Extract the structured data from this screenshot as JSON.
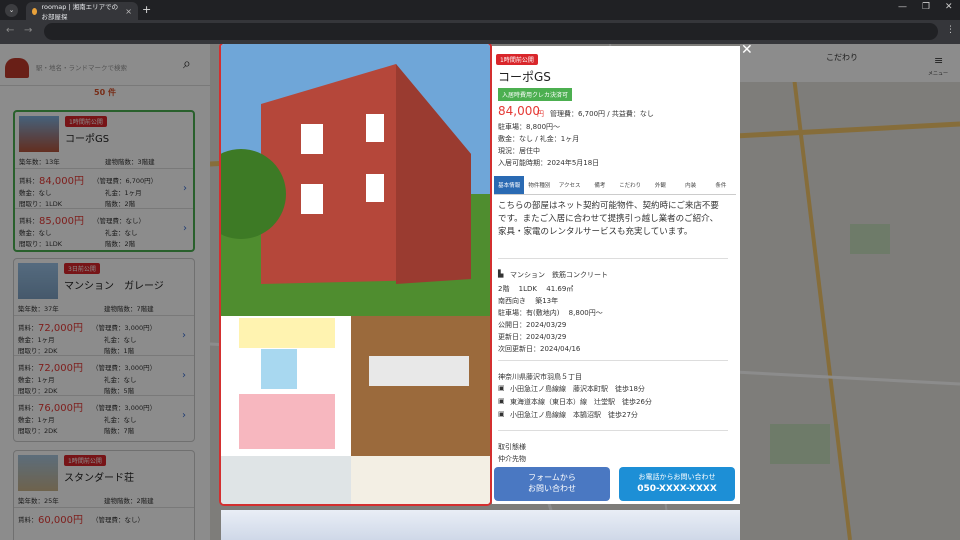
{
  "browser": {
    "tab_title": "roomap | 湘南エリアでのお部屋探",
    "tab_close": "×",
    "new_tab": "+",
    "tab_menu": "⌄",
    "back": "←",
    "forward": "→",
    "minimize": "—",
    "maximize": "❐",
    "close": "✕",
    "menu": "⋮"
  },
  "search": {
    "placeholder": "駅・地名・ランドマークで検索",
    "icon": "search-icon"
  },
  "result_count": "50 件",
  "listings": [
    {
      "badge": "1時間前公開",
      "name": "コーポGS",
      "age": "築年数：13年",
      "floors": "建物階数：3階建",
      "units": [
        {
          "rent": "84,000円",
          "fee": "（管理費：6,700円）",
          "deposit": "敷金：なし",
          "key": "礼金：1ヶ月",
          "layout": "間取り：1LDK",
          "floor": "階数：2階"
        },
        {
          "rent": "85,000円",
          "fee": "（管理費：なし）",
          "deposit": "敷金：なし",
          "key": "礼金：なし",
          "layout": "間取り：1LDK",
          "floor": "階数：2階"
        }
      ]
    },
    {
      "badge": "3日前公開",
      "name": "マンション　ガレージ",
      "age": "築年数：37年",
      "floors": "建物階数：7階建",
      "units": [
        {
          "rent": "72,000円",
          "fee": "（管理費：3,000円）",
          "deposit": "敷金：1ヶ月",
          "key": "礼金：なし",
          "layout": "間取り：2DK",
          "floor": "階数：1階"
        },
        {
          "rent": "72,000円",
          "fee": "（管理費：3,000円）",
          "deposit": "敷金：1ヶ月",
          "key": "礼金：なし",
          "layout": "間取り：2DK",
          "floor": "階数：5階"
        },
        {
          "rent": "76,000円",
          "fee": "（管理費：3,000円）",
          "deposit": "敷金：1ヶ月",
          "key": "礼金：なし",
          "layout": "間取り：2DK",
          "floor": "階数：7階"
        }
      ]
    },
    {
      "badge": "1時間前公開",
      "name": "スタンダード荘",
      "age": "築年数：25年",
      "floors": "建物階数：2階建",
      "units": [
        {
          "rent": "60,000円",
          "fee": "（管理費：なし）"
        }
      ]
    }
  ],
  "map_header": {
    "filter": "こだわり",
    "menu": "メニュー"
  },
  "detail": {
    "badge": "1時間前公開",
    "name": "コーポGS",
    "card_tag": "入居時費用クレカ決済可",
    "rent": "84,000",
    "rent_unit": "円",
    "fee": "管理費：6,700円 / 共益費：なし",
    "parking": "駐車場：8,800円～",
    "deposit": "敷金：なし / 礼金：1ヶ月",
    "status": "現況：居住中",
    "move_in": "入居可能時期：2024年5月18日",
    "tabs": [
      "基本情報",
      "物件種別",
      "アクセス",
      "備考",
      "こだわり",
      "外観",
      "内装",
      "条件"
    ],
    "description": "こちらの部屋はネット契約可能物件、契約時にご来店不要です。またご入居に合わせて提携引っ越し業者のご紹介、家具・家電のレンタルサービスも充実しています。",
    "structure": "マンション　鉄筋コンクリート",
    "spec": "2階　 1LDK　 41.69㎡",
    "direction": "南西向き　 築13年",
    "parking2": "駐車場：有(敷地内)　 8,800円～",
    "published": "公開日：2024/03/29",
    "updated": "更新日：2024/03/29",
    "next_update": "次回更新日：2024/04/16",
    "address": "神奈川県藤沢市羽鳥５丁目",
    "stations": [
      "小田急江ノ島線線　藤沢本町駅　徒歩18分",
      "東海道本線（東日本）線　辻堂駅　徒歩26分",
      "小田急江ノ島線線　本鵠沼駅　徒歩27分"
    ],
    "deal_type": "取引態様",
    "deal_value": "仲介先物",
    "cta_form": "フォームから\nお問い合わせ",
    "cta_phone_label": "お電話からお問い合わせ",
    "cta_phone_number": "050-XXXX-XXXX"
  },
  "colors": {
    "accent": "#2a6ab3",
    "price": "#e53935",
    "badge": "#d9262b",
    "selected": "#4caf50"
  }
}
